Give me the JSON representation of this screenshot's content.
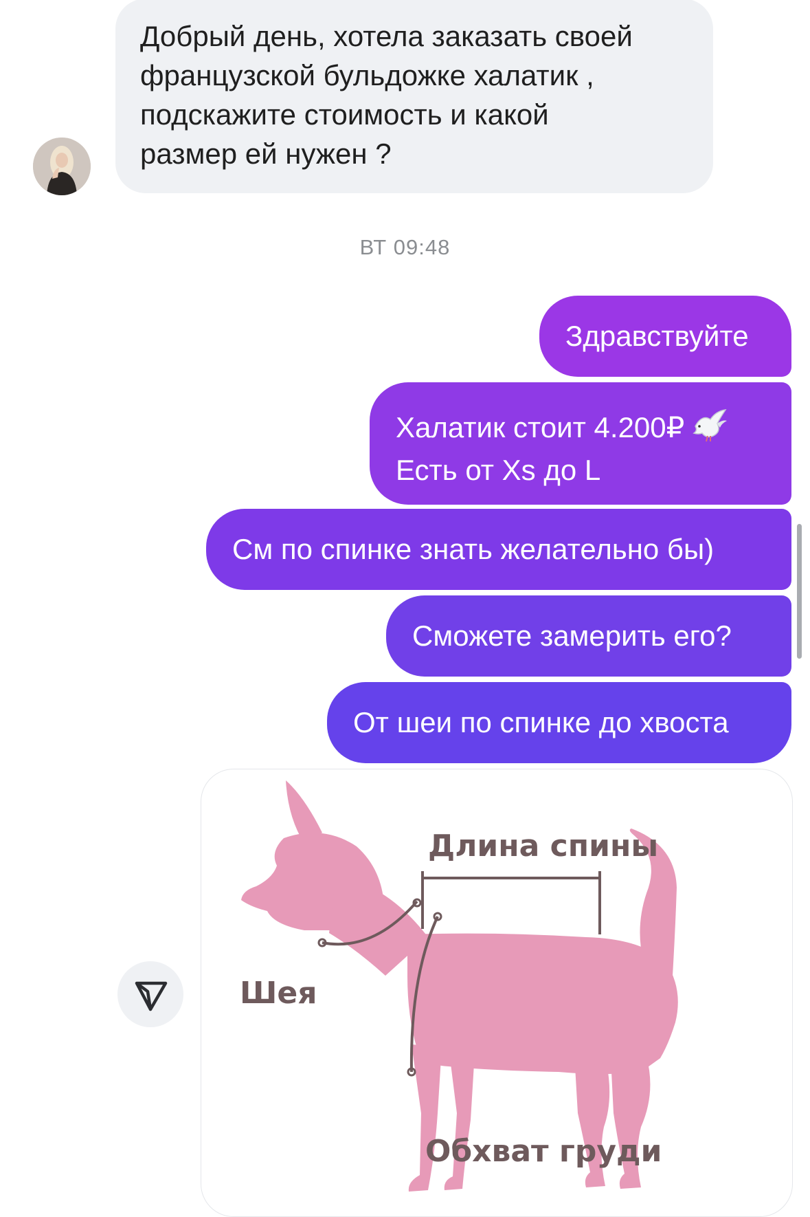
{
  "incoming_message": {
    "lines": [
      "Добрый день, хотела заказать своей",
      "французской бульдожке халатик ,",
      "подскажите стоимость и какой",
      "размер ей нужен ?"
    ]
  },
  "timestamp": "ВТ 09:48",
  "outgoing_messages": [
    {
      "text": "Здравствуйте"
    },
    {
      "lines": [
        "Халатик стоит 4.200₽",
        "Есть от Xs до L"
      ],
      "emoji": "dove"
    },
    {
      "text": "См по спинке знать желательно бы)"
    },
    {
      "text": "Сможете замерить его?"
    },
    {
      "text": "От шеи по спинке до хвоста"
    }
  ],
  "image": {
    "labels": {
      "back_length": "Длина спины",
      "neck": "Шея",
      "chest": "Обхват груди"
    }
  },
  "icons": {
    "share": "send-icon",
    "avatar": "user-avatar"
  },
  "colors": {
    "incoming_bubble": "#eff1f4",
    "outgoing_gradient": [
      "#9b37e6",
      "#8f3ae6",
      "#7e3ae8",
      "#7140e8",
      "#6542eb"
    ],
    "dog_pink": "#e79ab8"
  }
}
